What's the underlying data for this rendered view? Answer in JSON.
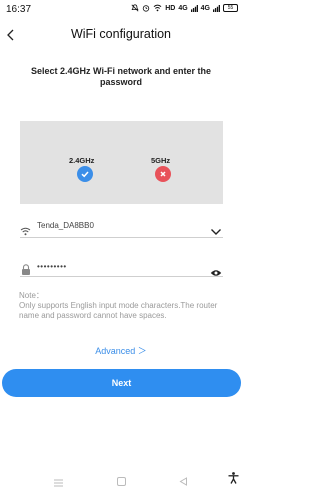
{
  "status_bar": {
    "time": "16:37",
    "hd_label": "HD",
    "signal1": "4G",
    "signal2": "4G",
    "battery": "55"
  },
  "header": {
    "title": "WiFi configuration"
  },
  "instruction": "Select 2.4GHz Wi-Fi network and enter the password",
  "bands": {
    "band1_label": "2.4GHz",
    "band2_label": "5GHz"
  },
  "network": {
    "ssid": "Tenda_DA8BB0",
    "password_masked": "•••••••••"
  },
  "note": {
    "title": "Note：",
    "body": " Only supports English input mode characters.The router name and password cannot have spaces."
  },
  "advanced_label": "Advanced ＞",
  "next_label": "Next",
  "colors": {
    "accent": "#2f8ef0",
    "ok": "#3b8ee8",
    "error": "#e8525a",
    "illustration_bg": "#e2e2e2"
  }
}
